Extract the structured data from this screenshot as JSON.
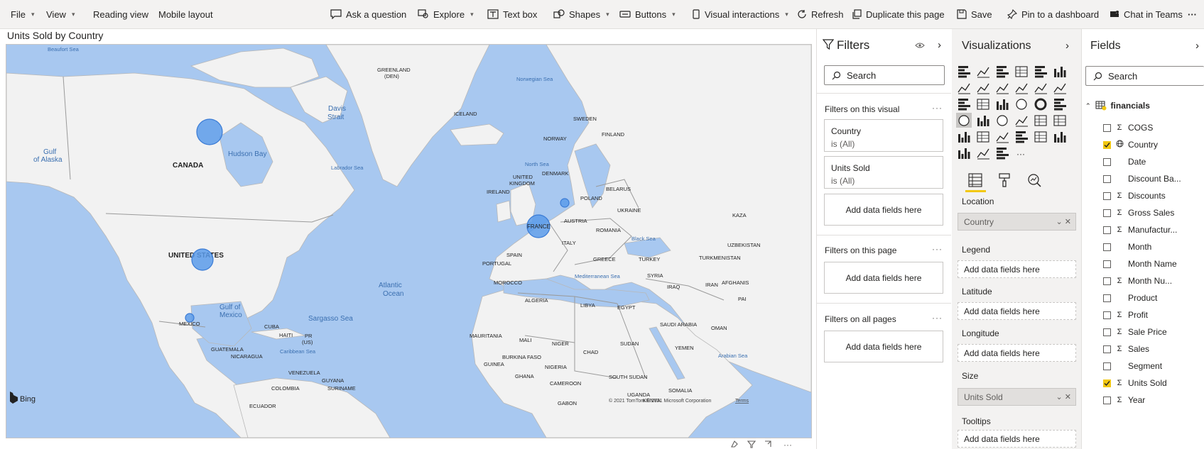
{
  "menu": {
    "file": "File",
    "view": "View",
    "reading_view": "Reading view",
    "mobile_layout": "Mobile layout",
    "ask_question": "Ask a question",
    "explore": "Explore",
    "text_box": "Text box",
    "shapes": "Shapes",
    "buttons": "Buttons",
    "visual_interactions": "Visual interactions",
    "refresh": "Refresh",
    "duplicate_page": "Duplicate this page",
    "save": "Save",
    "pin_dashboard": "Pin to a dashboard",
    "chat_teams": "Chat in Teams",
    "more": "···"
  },
  "visual": {
    "title": "Units Sold by Country",
    "bing": "Bing",
    "copyright": "© 2021 TomTom © 2021 Microsoft Corporation",
    "terms": "Terms"
  },
  "map_labels": {
    "beaufort": "Beaufort Sea",
    "greenland": "GREENLAND",
    "greenland_den": "(DEN)",
    "norwegian": "Norwegian Sea",
    "davis1": "Davis",
    "davis2": "Strait",
    "iceland": "ICELAND",
    "sweden": "SWEDEN",
    "finland": "FINLAND",
    "norway": "NORWAY",
    "gulf_alaska1": "Gulf",
    "gulf_alaska2": "of Alaska",
    "hudson": "Hudson Bay",
    "canada": "CANADA",
    "labrador": "Labrador Sea",
    "north_sea": "North Sea",
    "denmark": "DENMARK",
    "uk1": "UNITED",
    "uk2": "KINGDOM",
    "ireland": "IRELAND",
    "belarus": "BELARUS",
    "poland": "POLAND",
    "ukraine": "UKRAINE",
    "kaza": "KAZA",
    "austria": "AUSTRIA",
    "france": "FRANCE",
    "romania": "ROMANIA",
    "black_sea": "Black Sea",
    "uzbekistan": "UZBEKISTAN",
    "italy": "ITALY",
    "spain": "SPAIN",
    "portugal": "PORTUGAL",
    "greece": "GREECE",
    "turkey": "TURKEY",
    "turkmenistan": "TURKMENISTAN",
    "us": "UNITED STATES",
    "med_sea": "Mediterranean Sea",
    "syria": "SYRIA",
    "iraq": "IRAQ",
    "iran": "IRAN",
    "afghanistan": "AFGHANIS",
    "pak": "PAI",
    "morocco": "MOROCCO",
    "atlantic1": "Atlantic",
    "atlantic2": "Ocean",
    "algeria": "ALGERIA",
    "libya": "LIBYA",
    "egypt": "EGYPT",
    "gulf_mexico1": "Gulf of",
    "gulf_mexico2": "Mexico",
    "sargasso": "Sargasso Sea",
    "saudi": "SAUDI ARABIA",
    "oman": "OMAN",
    "mexico": "MEXICO",
    "cuba": "CUBA",
    "haiti": "HAITI",
    "pr1": "PR",
    "pr2": "(US)",
    "mauritania": "MAURITANIA",
    "mali": "MALI",
    "niger": "NIGER",
    "sudan": "SUDAN",
    "chad": "CHAD",
    "yemen": "YEMEN",
    "guatemala": "GUATEMALA",
    "nicaragua": "NICARAGUA",
    "caribbean": "Caribbean Sea",
    "burkina": "BURKINA FASO",
    "guinea": "GUINEA",
    "nigeria": "NIGERIA",
    "arabian": "Arabian Sea",
    "venezuela": "VENEZUELA",
    "guyana": "GUYANA",
    "suriname": "SURINAME",
    "ghana": "GHANA",
    "south_sudan": "SOUTH SUDAN",
    "colombia": "COLOMBIA",
    "cameroon": "CAMEROON",
    "uganda": "UGANDA",
    "kenya": "KENYA",
    "somalia": "SOMALIA",
    "ecuador": "ECUADOR",
    "gabon": "GABON"
  },
  "filters": {
    "title": "Filters",
    "search": "Search",
    "on_visual": "Filters on this visual",
    "on_page": "Filters on this page",
    "on_all": "Filters on all pages",
    "more": "···",
    "cards": [
      {
        "field": "Country",
        "state": "is (All)"
      },
      {
        "field": "Units Sold",
        "state": "is (All)"
      }
    ],
    "add_here": "Add data fields here"
  },
  "visualizations": {
    "title": "Visualizations",
    "wells": {
      "location": "Location",
      "location_value": "Country",
      "legend": "Legend",
      "latitude": "Latitude",
      "longitude": "Longitude",
      "size": "Size",
      "size_value": "Units Sold",
      "tooltips": "Tooltips",
      "add_here": "Add data fields here"
    },
    "more": "···",
    "accent": "#f2c811"
  },
  "fields": {
    "title": "Fields",
    "search": "Search",
    "table": "financials",
    "items": [
      {
        "name": "COGS",
        "sigma": true,
        "checked": false
      },
      {
        "name": "Country",
        "sigma": false,
        "globe": true,
        "checked": true
      },
      {
        "name": "Date",
        "sigma": false,
        "checked": false
      },
      {
        "name": "Discount Ba...",
        "sigma": false,
        "checked": false
      },
      {
        "name": "Discounts",
        "sigma": true,
        "checked": false
      },
      {
        "name": "Gross Sales",
        "sigma": true,
        "checked": false
      },
      {
        "name": "Manufactur...",
        "sigma": true,
        "checked": false
      },
      {
        "name": "Month",
        "sigma": false,
        "checked": false
      },
      {
        "name": "Month Name",
        "sigma": false,
        "checked": false
      },
      {
        "name": "Month Nu...",
        "sigma": true,
        "checked": false
      },
      {
        "name": "Product",
        "sigma": false,
        "checked": false
      },
      {
        "name": "Profit",
        "sigma": true,
        "checked": false
      },
      {
        "name": "Sale Price",
        "sigma": true,
        "checked": false
      },
      {
        "name": "Sales",
        "sigma": true,
        "checked": false
      },
      {
        "name": "Segment",
        "sigma": false,
        "checked": false
      },
      {
        "name": "Units Sold",
        "sigma": true,
        "checked": true
      },
      {
        "name": "Year",
        "sigma": true,
        "checked": false
      }
    ]
  },
  "colors": {
    "ocean": "#a8c8f0",
    "land": "#f2f2f2",
    "bubble": "#5b9bea",
    "bubble_border": "#3a7bd5"
  }
}
